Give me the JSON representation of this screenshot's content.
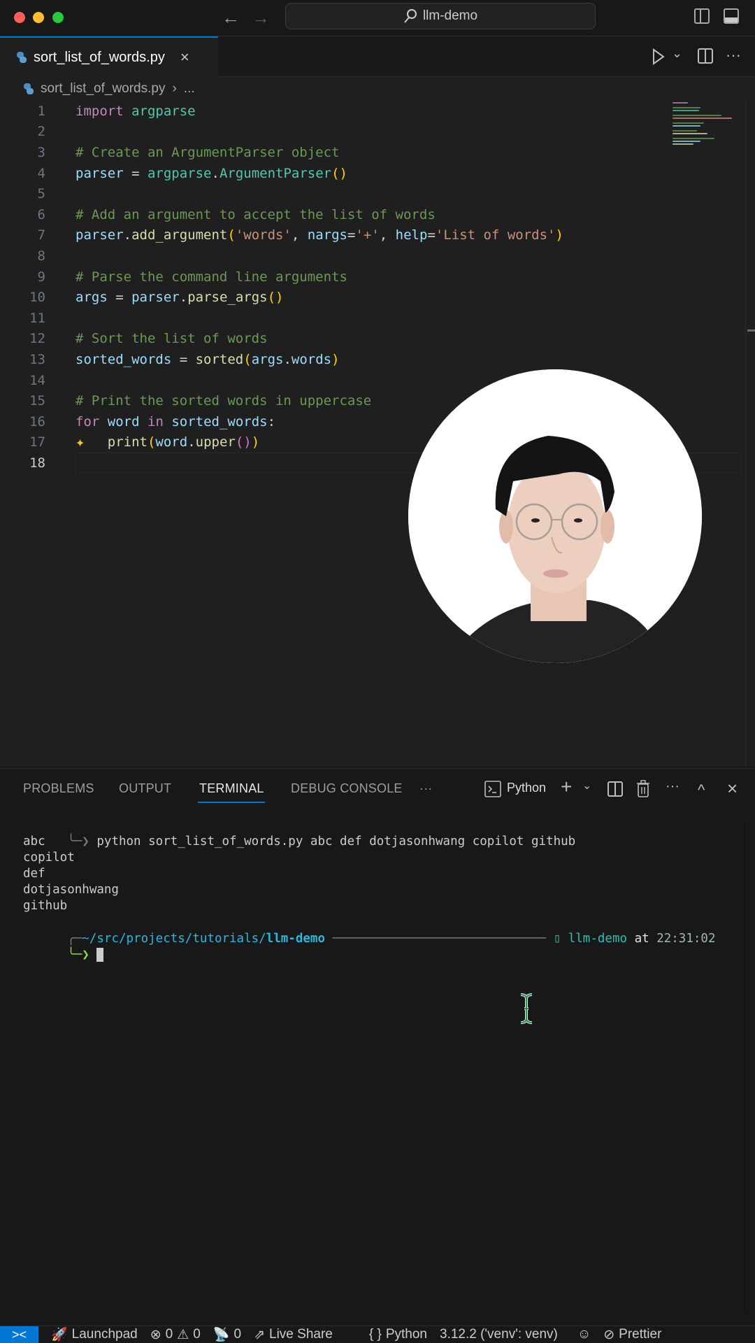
{
  "titlebar": {
    "search_text": "llm-demo",
    "icons": [
      "close-window",
      "minimize-window",
      "maximize-window",
      "arrow-left",
      "arrow-right",
      "search",
      "toggle-sidebar",
      "toggle-panel"
    ]
  },
  "tabs": [
    {
      "label": "sort_list_of_words.py",
      "active": true,
      "icon": "python-file-icon",
      "close": "×"
    }
  ],
  "tab_actions": {
    "run": "▷",
    "run_dropdown": "⌄",
    "split": "split-editor",
    "more": "···"
  },
  "breadcrumb": {
    "file": "sort_list_of_words.py",
    "separator": "›",
    "more": "..."
  },
  "editor": {
    "current_line": 18,
    "lines": [
      {
        "n": "1",
        "tokens": [
          [
            "kw",
            "import"
          ],
          [
            "op",
            " "
          ],
          [
            "mod",
            "argparse"
          ]
        ]
      },
      {
        "n": "2",
        "tokens": []
      },
      {
        "n": "3",
        "tokens": [
          [
            "cm",
            "# Create an ArgumentParser object"
          ]
        ]
      },
      {
        "n": "4",
        "tokens": [
          [
            "var",
            "parser"
          ],
          [
            "op",
            " = "
          ],
          [
            "mod",
            "argparse"
          ],
          [
            "op",
            "."
          ],
          [
            "mod",
            "ArgumentParser"
          ],
          [
            "b1",
            "()"
          ]
        ]
      },
      {
        "n": "5",
        "tokens": []
      },
      {
        "n": "6",
        "tokens": [
          [
            "cm",
            "# Add an argument to accept the list of words"
          ]
        ]
      },
      {
        "n": "7",
        "tokens": [
          [
            "var",
            "parser"
          ],
          [
            "op",
            "."
          ],
          [
            "fn",
            "add_argument"
          ],
          [
            "b1",
            "("
          ],
          [
            "str",
            "'words'"
          ],
          [
            "op",
            ", "
          ],
          [
            "var",
            "nargs"
          ],
          [
            "op",
            "="
          ],
          [
            "str",
            "'+'"
          ],
          [
            "op",
            ", "
          ],
          [
            "var",
            "help"
          ],
          [
            "op",
            "="
          ],
          [
            "str",
            "'List of words'"
          ],
          [
            "b1",
            ")"
          ]
        ]
      },
      {
        "n": "8",
        "tokens": []
      },
      {
        "n": "9",
        "tokens": [
          [
            "cm",
            "# Parse the command line arguments"
          ]
        ]
      },
      {
        "n": "10",
        "tokens": [
          [
            "var",
            "args"
          ],
          [
            "op",
            " = "
          ],
          [
            "var",
            "parser"
          ],
          [
            "op",
            "."
          ],
          [
            "fn",
            "parse_args"
          ],
          [
            "b1",
            "()"
          ]
        ]
      },
      {
        "n": "11",
        "tokens": []
      },
      {
        "n": "12",
        "tokens": [
          [
            "cm",
            "# Sort the list of words"
          ]
        ]
      },
      {
        "n": "13",
        "tokens": [
          [
            "var",
            "sorted_words"
          ],
          [
            "op",
            " = "
          ],
          [
            "fn",
            "sorted"
          ],
          [
            "b1",
            "("
          ],
          [
            "var",
            "args"
          ],
          [
            "op",
            "."
          ],
          [
            "var",
            "words"
          ],
          [
            "b1",
            ")"
          ]
        ]
      },
      {
        "n": "14",
        "tokens": []
      },
      {
        "n": "15",
        "tokens": [
          [
            "cm",
            "# Print the sorted words in uppercase"
          ]
        ]
      },
      {
        "n": "16",
        "tokens": [
          [
            "kw",
            "for"
          ],
          [
            "op",
            " "
          ],
          [
            "var",
            "word"
          ],
          [
            "op",
            " "
          ],
          [
            "kw",
            "in"
          ],
          [
            "op",
            " "
          ],
          [
            "var",
            "sorted_words"
          ],
          [
            "op",
            ":"
          ]
        ]
      },
      {
        "n": "17",
        "tokens": [
          [
            "op",
            "    "
          ],
          [
            "fn",
            "print"
          ],
          [
            "b1",
            "("
          ],
          [
            "var",
            "word"
          ],
          [
            "op",
            "."
          ],
          [
            "fn",
            "upper"
          ],
          [
            "b2",
            "()"
          ],
          [
            "b1",
            ")"
          ]
        ],
        "sparkle": "✦"
      },
      {
        "n": "18",
        "tokens": []
      }
    ]
  },
  "panel": {
    "tabs": [
      {
        "label": "PROBLEMS",
        "active": false
      },
      {
        "label": "OUTPUT",
        "active": false
      },
      {
        "label": "TERMINAL",
        "active": true
      },
      {
        "label": "DEBUG CONSOLE",
        "active": false
      }
    ],
    "more": "···",
    "terminal_name": "Python",
    "actions": {
      "new": "+",
      "dropdown": "⌄",
      "split": "split-terminal",
      "kill": "trash",
      "more": "···",
      "maximize": "^",
      "close": "×"
    }
  },
  "terminal": {
    "command_prompt": "╰─❯",
    "command": "python sort_list_of_words.py abc def dotjasonhwang copilot github",
    "output": [
      "abc",
      "copilot",
      "def",
      "dotjasonhwang",
      "github"
    ],
    "prompt_path_prefix": "~/src/projects/tutorials/",
    "prompt_path_dir": "llm-demo",
    "prompt_rule": "─────────────────────────────",
    "prompt_glyph": "▯",
    "prompt_env": "llm-demo",
    "prompt_at": "at",
    "prompt_time": "22:31:02",
    "prompt_corner": "╭─",
    "input_prompt": "╰─❯"
  },
  "statusbar": {
    "remote_icon": "><",
    "launchpad": "Launchpad",
    "errors": "0",
    "warnings": "0",
    "ports": "0",
    "live_share": "Live Share",
    "language_icon": "{ }",
    "language": "Python",
    "interpreter": "3.12.2 ('venv': venv)",
    "prettier": "Prettier"
  },
  "colors": {
    "accent": "#0078d4",
    "editor_bg": "#1f1f1f",
    "panel_bg": "#181818",
    "comment": "#6a9955",
    "keyword": "#c586c0",
    "module": "#4ec9b0",
    "variable": "#9cdcfe",
    "function": "#dcdcaa",
    "string": "#ce9178",
    "prompt_green": "#8ae234",
    "path_blue": "#29b8db"
  }
}
